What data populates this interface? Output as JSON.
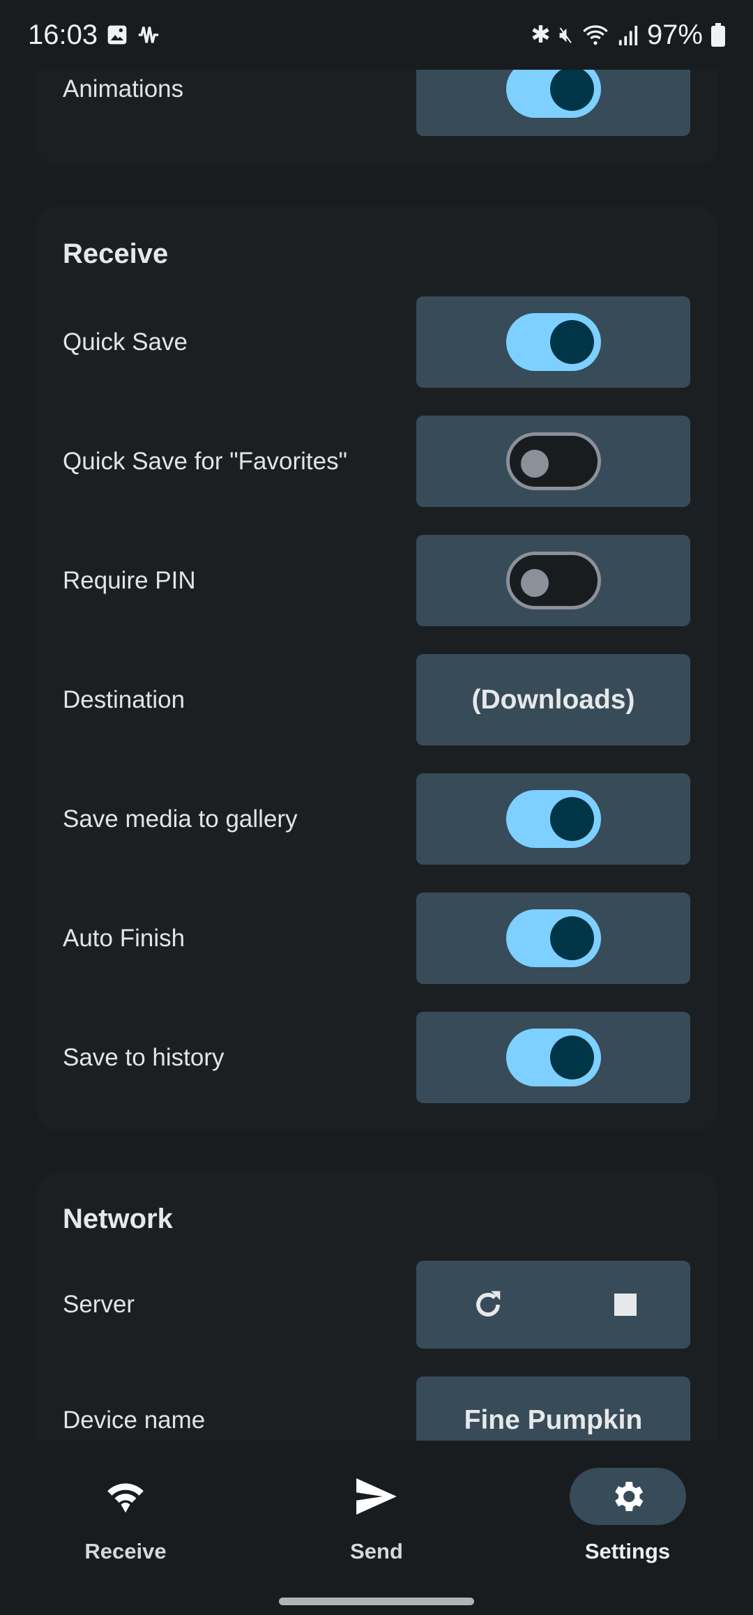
{
  "status_bar": {
    "time": "16:03",
    "battery": "97%"
  },
  "general": {
    "rows": [
      {
        "label": "Animations",
        "type": "toggle",
        "on": true
      }
    ]
  },
  "receive": {
    "title": "Receive",
    "rows": [
      {
        "label": "Quick Save",
        "type": "toggle",
        "on": true
      },
      {
        "label": "Quick Save for \"Favorites\"",
        "type": "toggle",
        "on": false
      },
      {
        "label": "Require PIN",
        "type": "toggle",
        "on": false
      },
      {
        "label": "Destination",
        "type": "button",
        "value": "(Downloads)"
      },
      {
        "label": "Save media to gallery",
        "type": "toggle",
        "on": true
      },
      {
        "label": "Auto Finish",
        "type": "toggle",
        "on": true
      },
      {
        "label": "Save to history",
        "type": "toggle",
        "on": true
      }
    ]
  },
  "network": {
    "title": "Network",
    "server_label": "Server",
    "device_name_label": "Device name",
    "device_name": "Fine Pumpkin"
  },
  "nav": {
    "items": [
      {
        "label": "Receive",
        "icon": "wifi-icon"
      },
      {
        "label": "Send",
        "icon": "send-icon"
      },
      {
        "label": "Settings",
        "icon": "gear-icon",
        "active": true
      }
    ]
  },
  "colors": {
    "accent": "#7dd0ff",
    "box": "#384b58",
    "background": "#191c1f"
  }
}
